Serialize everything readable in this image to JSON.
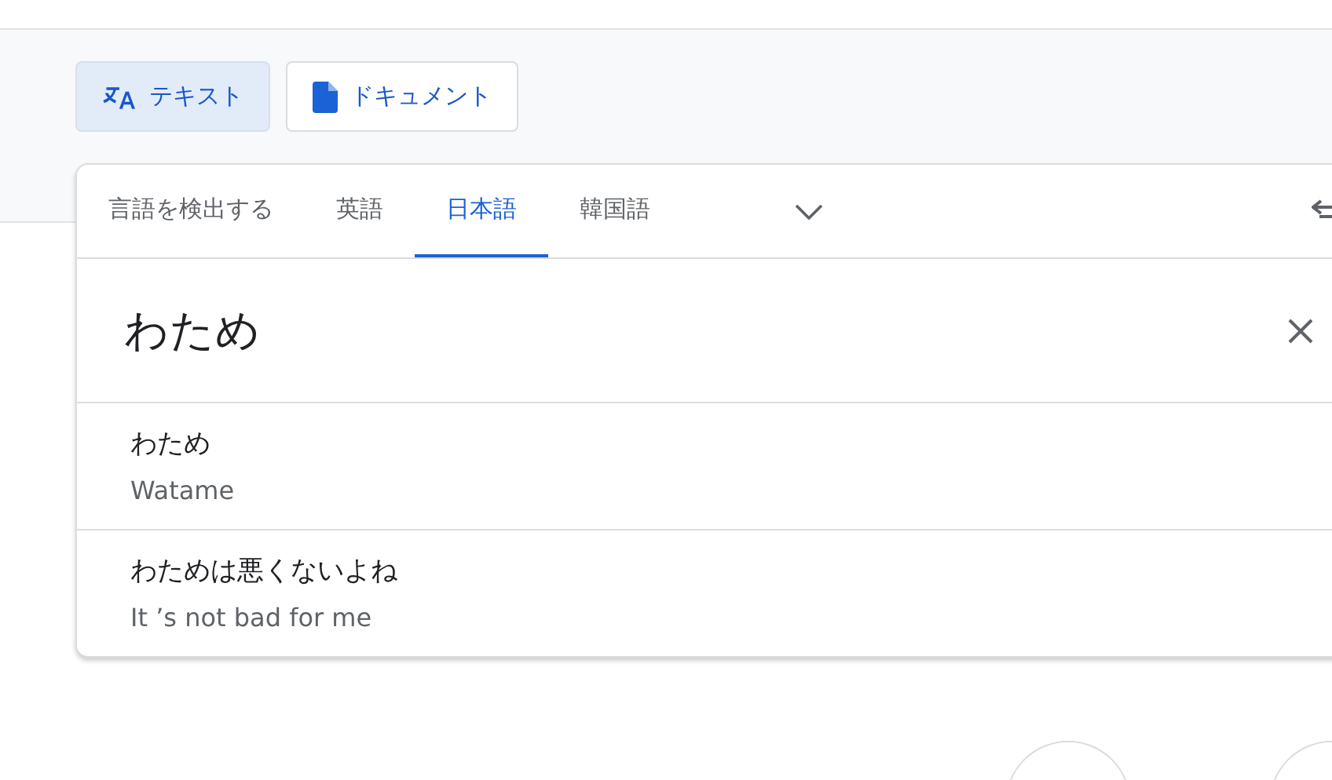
{
  "modes": [
    {
      "label": "テキスト",
      "kind": "text",
      "selected": true
    },
    {
      "label": "ドキュメント",
      "kind": "document",
      "selected": false
    }
  ],
  "source_tabs": [
    {
      "label": "言語を検出する",
      "selected": false
    },
    {
      "label": "英語",
      "selected": false
    },
    {
      "label": "日本語",
      "selected": true
    },
    {
      "label": "韓国語",
      "selected": false
    }
  ],
  "input": {
    "value": "わため"
  },
  "suggestions": [
    {
      "text": "わため",
      "translation": "Watame"
    },
    {
      "text": "わためは悪くないよね",
      "translation": "It ’s not bad for me"
    }
  ]
}
